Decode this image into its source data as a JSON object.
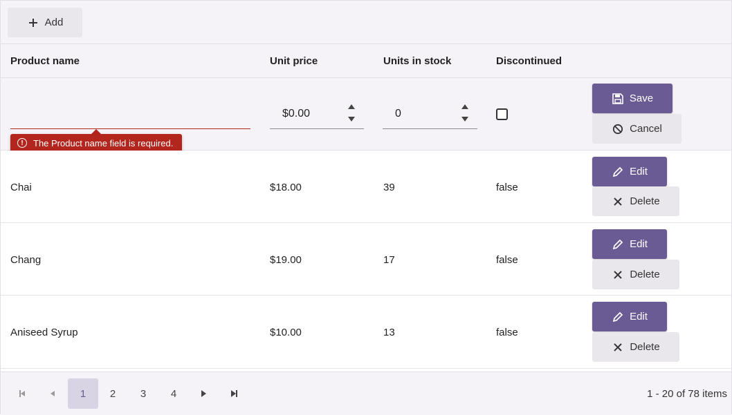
{
  "toolbar": {
    "add_label": "Add"
  },
  "columns": {
    "product_name": "Product name",
    "unit_price": "Unit price",
    "units_in_stock": "Units in stock",
    "discontinued": "Discontinued"
  },
  "edit_row": {
    "product_name_value": "",
    "unit_price_value": "$0.00",
    "units_in_stock_value": "0",
    "discontinued_checked": false,
    "validation_message": "The Product name field is required.",
    "save_label": "Save",
    "cancel_label": "Cancel"
  },
  "rows": [
    {
      "product_name": "Chai",
      "unit_price": "$18.00",
      "units_in_stock": "39",
      "discontinued": "false",
      "edit_label": "Edit",
      "delete_label": "Delete"
    },
    {
      "product_name": "Chang",
      "unit_price": "$19.00",
      "units_in_stock": "17",
      "discontinued": "false",
      "edit_label": "Edit",
      "delete_label": "Delete"
    },
    {
      "product_name": "Aniseed Syrup",
      "unit_price": "$10.00",
      "units_in_stock": "13",
      "discontinued": "false",
      "edit_label": "Edit",
      "delete_label": "Delete"
    }
  ],
  "pager": {
    "pages": [
      "1",
      "2",
      "3",
      "4"
    ],
    "current_page": "1",
    "info": "1 - 20 of 78 items"
  },
  "colors": {
    "accent": "#6b5b95",
    "error": "#b3261e",
    "toolbar_bg": "#f5f3f7"
  },
  "icons": [
    "plus-icon",
    "save-icon",
    "cancel-icon",
    "edit-icon",
    "delete-icon",
    "error-icon",
    "first-page-icon",
    "prev-page-icon",
    "next-page-icon",
    "last-page-icon"
  ]
}
